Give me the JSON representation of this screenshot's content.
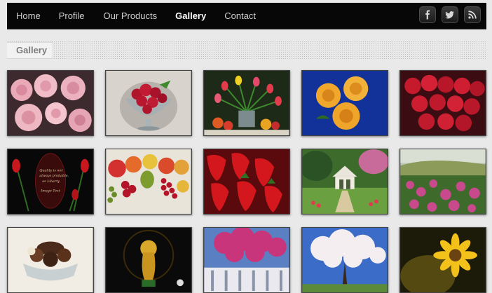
{
  "nav": {
    "items": [
      {
        "label": "Home",
        "active": false
      },
      {
        "label": "Profile",
        "active": false
      },
      {
        "label": "Our Products",
        "active": false
      },
      {
        "label": "Gallery",
        "active": true
      },
      {
        "label": "Contact",
        "active": false
      }
    ]
  },
  "social": [
    "facebook-icon",
    "twitter-icon",
    "rss-icon"
  ],
  "page": {
    "title": "Gallery"
  },
  "gallery": {
    "items": [
      {
        "name": "pink-roses"
      },
      {
        "name": "raspberries-bowl"
      },
      {
        "name": "tulips-fruit"
      },
      {
        "name": "yellow-roses"
      },
      {
        "name": "raspberries-closeup"
      },
      {
        "name": "red-tulips-quote"
      },
      {
        "name": "fruit-assortment"
      },
      {
        "name": "strawberries"
      },
      {
        "name": "garden-gazebo"
      },
      {
        "name": "flower-field"
      },
      {
        "name": "chocolates"
      },
      {
        "name": "world-cup-trophy"
      },
      {
        "name": "pink-blossom-tree"
      },
      {
        "name": "white-blossom-tree"
      },
      {
        "name": "sunflower"
      }
    ]
  },
  "colors": {
    "bar": "#070707",
    "page_bg": "#e9e9e9",
    "active_nav": "#ffffff"
  }
}
